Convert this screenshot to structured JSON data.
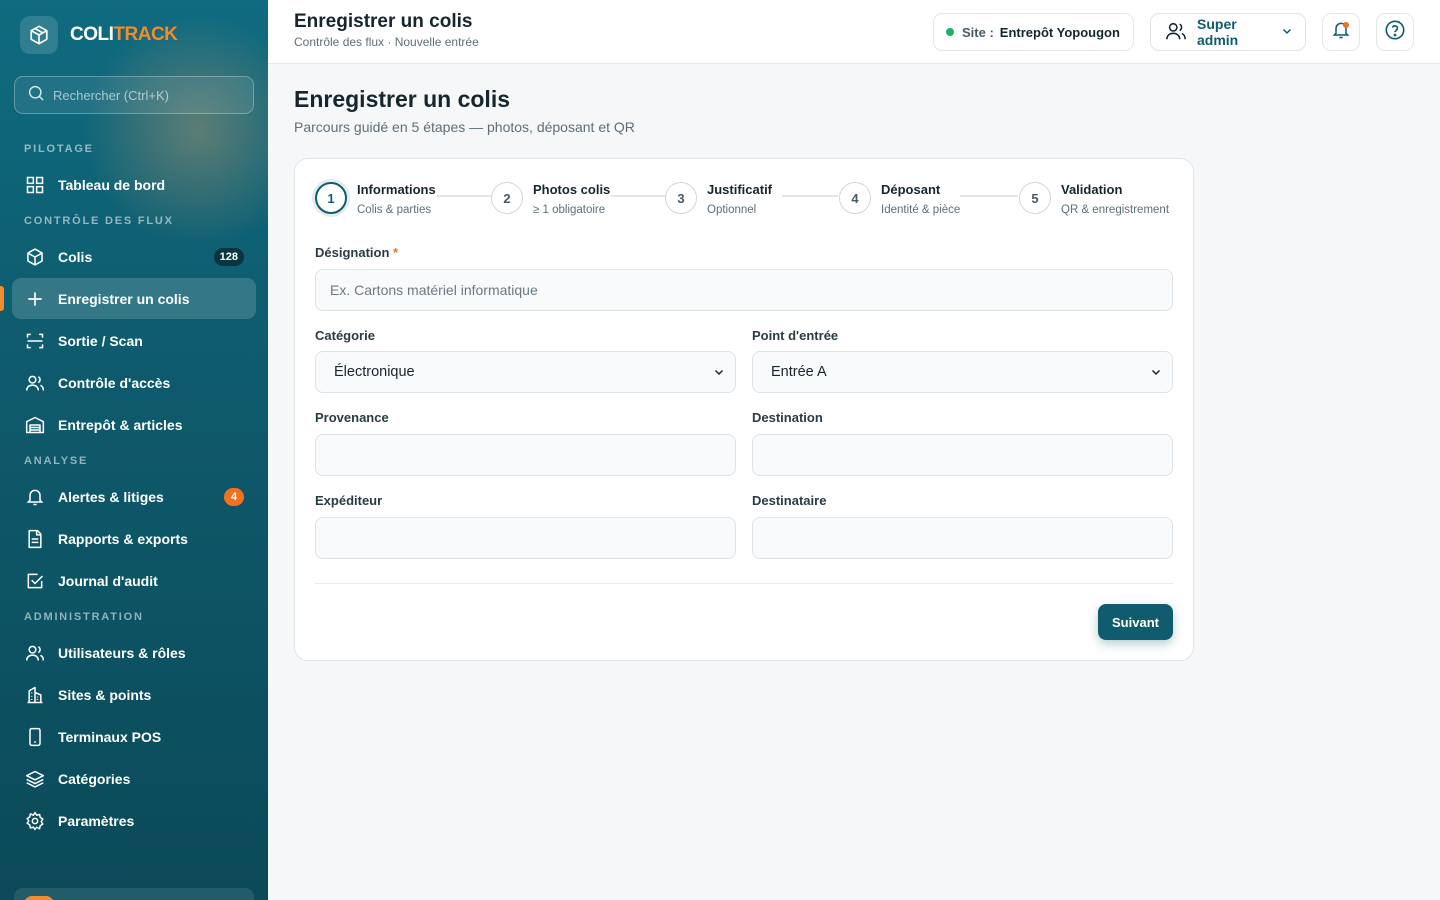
{
  "brand": {
    "name_part1": "COLI",
    "name_part2": "TRACK"
  },
  "search": {
    "placeholder": "Rechercher (Ctrl+K)"
  },
  "sidebar": {
    "sections": [
      {
        "title": "PILOTAGE",
        "items": [
          {
            "label": "Tableau de bord",
            "icon": "dashboard-icon"
          }
        ]
      },
      {
        "title": "CONTRÔLE DES FLUX",
        "items": [
          {
            "label": "Colis",
            "icon": "package-icon",
            "badge": "128"
          },
          {
            "label": "Enregistrer un colis",
            "icon": "plus-icon",
            "active": true
          },
          {
            "label": "Sortie / Scan",
            "icon": "scan-icon"
          },
          {
            "label": "Contrôle d'accès",
            "icon": "users-icon"
          },
          {
            "label": "Entrepôt & articles",
            "icon": "warehouse-icon"
          }
        ]
      },
      {
        "title": "ANALYSE",
        "items": [
          {
            "label": "Alertes & litiges",
            "icon": "bell-icon",
            "badge": "4"
          },
          {
            "label": "Rapports & exports",
            "icon": "report-icon"
          },
          {
            "label": "Journal d'audit",
            "icon": "audit-icon"
          }
        ]
      },
      {
        "title": "ADMINISTRATION",
        "items": [
          {
            "label": "Utilisateurs & rôles",
            "icon": "users-icon"
          },
          {
            "label": "Sites & points",
            "icon": "building-icon"
          },
          {
            "label": "Terminaux POS",
            "icon": "device-icon"
          },
          {
            "label": "Catégories",
            "icon": "layers-icon"
          },
          {
            "label": "Paramètres",
            "icon": "gear-icon"
          }
        ]
      }
    ]
  },
  "topbar": {
    "title": "Enregistrer un colis",
    "subtitle": "Contrôle des flux · Nouvelle entrée",
    "site_label": "Site :",
    "site_value": "Entrepôt Yopougon",
    "user": "Super admin"
  },
  "page": {
    "title": "Enregistrer un colis",
    "subtitle": "Parcours guidé en 5 étapes — photos, déposant et QR"
  },
  "steps": [
    {
      "num": "1",
      "title": "Informations",
      "sub": "Colis & parties"
    },
    {
      "num": "2",
      "title": "Photos colis",
      "sub": "≥ 1 obligatoire"
    },
    {
      "num": "3",
      "title": "Justificatif",
      "sub": "Optionnel"
    },
    {
      "num": "4",
      "title": "Déposant",
      "sub": "Identité & pièce"
    },
    {
      "num": "5",
      "title": "Validation",
      "sub": "QR & enregistrement"
    }
  ],
  "form": {
    "designation": {
      "label": "Désignation",
      "required": "*",
      "placeholder": "Ex. Cartons matériel informatique",
      "value": ""
    },
    "categorie": {
      "label": "Catégorie",
      "value": "Électronique"
    },
    "point_entree": {
      "label": "Point d'entrée",
      "value": "Entrée A"
    },
    "provenance": {
      "label": "Provenance",
      "value": ""
    },
    "destination": {
      "label": "Destination",
      "value": ""
    },
    "expediteur": {
      "label": "Expéditeur",
      "value": ""
    },
    "destinataire": {
      "label": "Destinataire",
      "value": ""
    },
    "next_label": "Suivant"
  },
  "colors": {
    "primary": "#0f5c6e",
    "accent": "#f28a2e",
    "badge_orange": "#f2701e",
    "status_green": "#1bb36b"
  }
}
